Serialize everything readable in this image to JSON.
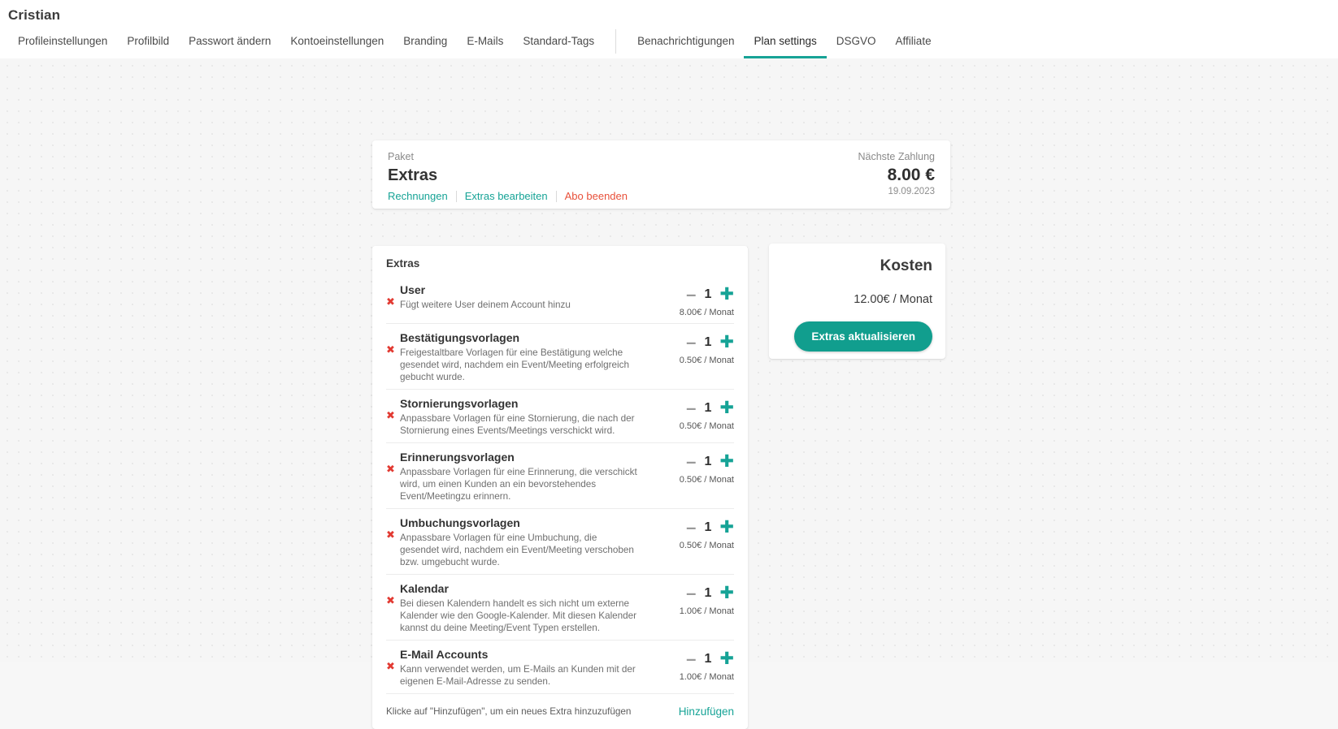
{
  "header": {
    "title": "Cristian",
    "tabs": [
      {
        "label": "Profileinstellungen",
        "active": false
      },
      {
        "label": "Profilbild",
        "active": false
      },
      {
        "label": "Passwort ändern",
        "active": false
      },
      {
        "label": "Kontoeinstellungen",
        "active": false
      },
      {
        "label": "Branding",
        "active": false
      },
      {
        "label": "E-Mails",
        "active": false
      },
      {
        "label": "Standard-Tags",
        "active": false
      },
      {
        "label": "Benachrichtigungen",
        "active": false
      },
      {
        "label": "Plan settings",
        "active": true
      },
      {
        "label": "DSGVO",
        "active": false
      },
      {
        "label": "Affiliate",
        "active": false
      }
    ],
    "separator_after_index": 6
  },
  "plan_card": {
    "package_label": "Paket",
    "package_name": "Extras",
    "actions": [
      {
        "label": "Rechnungen",
        "style": "teal"
      },
      {
        "label": "Extras bearbeiten",
        "style": "teal"
      },
      {
        "label": "Abo beenden",
        "style": "red"
      }
    ],
    "next_payment_label": "Nächste Zahlung",
    "next_payment_amount": "8.00 €",
    "next_payment_date": "19.09.2023"
  },
  "extras_card": {
    "heading": "Extras",
    "remove_icon": "✖",
    "minus_icon": "–",
    "plus_icon": "✚",
    "items": [
      {
        "name": "User",
        "description": "Fügt weitere User deinem Account hinzu",
        "quantity": "1",
        "price": "8.00€ / Monat"
      },
      {
        "name": "Bestätigungsvorlagen",
        "description": "Freigestaltbare Vorlagen für eine Bestätigung welche gesendet wird, nachdem ein Event/Meeting erfolgreich gebucht wurde.",
        "quantity": "1",
        "price": "0.50€ / Monat"
      },
      {
        "name": "Stornierungsvorlagen",
        "description": "Anpassbare Vorlagen für eine Stornierung, die nach der Stornierung eines Events/Meetings verschickt wird.",
        "quantity": "1",
        "price": "0.50€ / Monat"
      },
      {
        "name": "Erinnerungsvorlagen",
        "description": "Anpassbare Vorlagen für eine Erinnerung, die verschickt wird, um einen Kunden an ein bevorstehendes Event/Meetingzu erinnern.",
        "quantity": "1",
        "price": "0.50€ / Monat"
      },
      {
        "name": "Umbuchungsvorlagen",
        "description": "Anpassbare Vorlagen für eine Umbuchung, die gesendet wird, nachdem ein Event/Meeting verschoben bzw. umgebucht wurde.",
        "quantity": "1",
        "price": "0.50€ / Monat"
      },
      {
        "name": "Kalendar",
        "description": "Bei diesen Kalendern handelt es sich nicht um externe Kalender wie den Google-Kalender. Mit diesen Kalender kannst du deine Meeting/Event Typen erstellen.",
        "quantity": "1",
        "price": "1.00€ / Monat"
      },
      {
        "name": "E-Mail Accounts",
        "description": "Kann verwendet werden, um E-Mails an Kunden mit der eigenen E-Mail-Adresse zu senden.",
        "quantity": "1",
        "price": "1.00€ / Monat"
      }
    ],
    "footer_hint": "Klicke auf \"Hinzufügen\", um ein neues Extra hinzuzufügen",
    "footer_add_label": "Hinzufügen"
  },
  "kosten_card": {
    "title": "Kosten",
    "amount": "12.00€ / Monat",
    "button_label": "Extras aktualisieren"
  },
  "colors": {
    "accent_teal": "#16a396",
    "button_teal": "#119e8e",
    "danger_red": "#e8503a",
    "remove_red": "#e23a32",
    "page_bg": "#f6f6f6"
  }
}
